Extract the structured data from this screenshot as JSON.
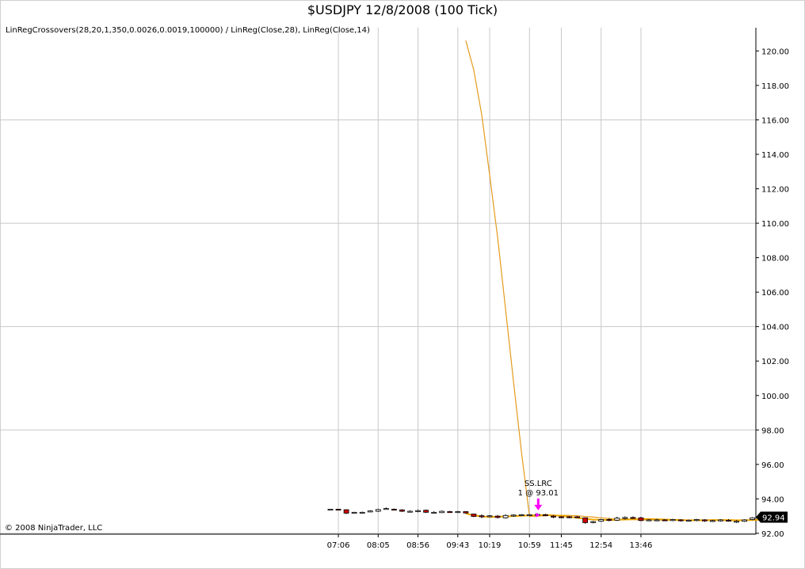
{
  "chart_data": {
    "type": "candlestick",
    "title": "$USDJPY  12/8/2008 (100 Tick)",
    "indicator_label": "LinRegCrossovers(28,20,1,350,0.0026,0.0019,100000) / LinReg(Close,28), LinReg(Close,14)",
    "copyright": "© 2008 NinjaTrader, LLC",
    "ylim": [
      91.95,
      121.35
    ],
    "y_ticks": [
      92.0,
      94.0,
      96.0,
      98.0,
      100.0,
      102.0,
      104.0,
      106.0,
      108.0,
      110.0,
      112.0,
      114.0,
      116.0,
      118.0,
      120.0
    ],
    "y_tick_labels": [
      "92.00",
      "94.00",
      "96.00",
      "98.00",
      "100.00",
      "102.00",
      "104.00",
      "106.00",
      "108.00",
      "110.00",
      "112.00",
      "114.00",
      "116.00",
      "118.00",
      "120.00"
    ],
    "y_major_grid": [
      92.0,
      98.0,
      104.0,
      110.0,
      116.0
    ],
    "x_labels": [
      "07:06",
      "08:05",
      "08:56",
      "09:43",
      "10:19",
      "10:59",
      "11:45",
      "12:54",
      "13:46"
    ],
    "bar_count": 55,
    "x_label_bars": [
      1,
      6,
      11,
      16,
      20,
      25,
      29,
      34,
      39
    ],
    "candles": [
      {
        "o": 93.4,
        "h": 93.42,
        "l": 93.38,
        "c": 93.4
      },
      {
        "o": 93.4,
        "h": 93.42,
        "l": 93.36,
        "c": 93.38
      },
      {
        "o": 93.37,
        "h": 93.4,
        "l": 93.12,
        "c": 93.17
      },
      {
        "o": 93.18,
        "h": 93.25,
        "l": 93.15,
        "c": 93.22
      },
      {
        "o": 93.22,
        "h": 93.26,
        "l": 93.18,
        "c": 93.22
      },
      {
        "o": 93.24,
        "h": 93.34,
        "l": 93.22,
        "c": 93.3
      },
      {
        "o": 93.28,
        "h": 93.42,
        "l": 93.24,
        "c": 93.38
      },
      {
        "o": 93.44,
        "h": 93.5,
        "l": 93.4,
        "c": 93.44
      },
      {
        "o": 93.4,
        "h": 93.44,
        "l": 93.34,
        "c": 93.38
      },
      {
        "o": 93.36,
        "h": 93.4,
        "l": 93.24,
        "c": 93.28
      },
      {
        "o": 93.28,
        "h": 93.34,
        "l": 93.22,
        "c": 93.28
      },
      {
        "o": 93.26,
        "h": 93.38,
        "l": 93.22,
        "c": 93.32
      },
      {
        "o": 93.34,
        "h": 93.38,
        "l": 93.18,
        "c": 93.22
      },
      {
        "o": 93.22,
        "h": 93.28,
        "l": 93.16,
        "c": 93.22
      },
      {
        "o": 93.2,
        "h": 93.32,
        "l": 93.18,
        "c": 93.28
      },
      {
        "o": 93.26,
        "h": 93.3,
        "l": 93.2,
        "c": 93.24
      },
      {
        "o": 93.22,
        "h": 93.3,
        "l": 93.18,
        "c": 93.26
      },
      {
        "o": 93.26,
        "h": 93.28,
        "l": 93.14,
        "c": 93.18
      },
      {
        "o": 93.12,
        "h": 93.14,
        "l": 92.94,
        "c": 92.98
      },
      {
        "o": 93.02,
        "h": 93.1,
        "l": 92.88,
        "c": 92.96
      },
      {
        "o": 92.98,
        "h": 93.06,
        "l": 92.92,
        "c": 93.02
      },
      {
        "o": 93.0,
        "h": 93.06,
        "l": 92.86,
        "c": 92.92
      },
      {
        "o": 92.9,
        "h": 93.1,
        "l": 92.86,
        "c": 93.04
      },
      {
        "o": 93.02,
        "h": 93.1,
        "l": 92.96,
        "c": 93.06
      },
      {
        "o": 93.04,
        "h": 93.12,
        "l": 93.0,
        "c": 93.08
      },
      {
        "o": 93.06,
        "h": 93.12,
        "l": 93.0,
        "c": 93.08
      },
      {
        "o": 93.06,
        "h": 93.16,
        "l": 93.02,
        "c": 93.1
      },
      {
        "o": 93.08,
        "h": 93.14,
        "l": 93.0,
        "c": 93.02
      },
      {
        "o": 93.0,
        "h": 93.06,
        "l": 92.88,
        "c": 92.94
      },
      {
        "o": 92.96,
        "h": 93.0,
        "l": 92.88,
        "c": 92.94
      },
      {
        "o": 92.96,
        "h": 93.0,
        "l": 92.88,
        "c": 92.94
      },
      {
        "o": 92.96,
        "h": 93.0,
        "l": 92.9,
        "c": 92.92
      },
      {
        "o": 92.9,
        "h": 92.92,
        "l": 92.56,
        "c": 92.62
      },
      {
        "o": 92.66,
        "h": 92.72,
        "l": 92.58,
        "c": 92.68
      },
      {
        "o": 92.7,
        "h": 92.84,
        "l": 92.66,
        "c": 92.8
      },
      {
        "o": 92.8,
        "h": 92.88,
        "l": 92.7,
        "c": 92.78
      },
      {
        "o": 92.76,
        "h": 92.96,
        "l": 92.72,
        "c": 92.88
      },
      {
        "o": 92.86,
        "h": 92.98,
        "l": 92.8,
        "c": 92.92
      },
      {
        "o": 92.92,
        "h": 92.98,
        "l": 92.84,
        "c": 92.88
      },
      {
        "o": 92.9,
        "h": 92.96,
        "l": 92.7,
        "c": 92.74
      },
      {
        "o": 92.74,
        "h": 92.82,
        "l": 92.7,
        "c": 92.78
      },
      {
        "o": 92.76,
        "h": 92.84,
        "l": 92.7,
        "c": 92.78
      },
      {
        "o": 92.78,
        "h": 92.82,
        "l": 92.72,
        "c": 92.76
      },
      {
        "o": 92.74,
        "h": 92.84,
        "l": 92.7,
        "c": 92.8
      },
      {
        "o": 92.78,
        "h": 92.82,
        "l": 92.68,
        "c": 92.74
      },
      {
        "o": 92.72,
        "h": 92.8,
        "l": 92.68,
        "c": 92.76
      },
      {
        "o": 92.76,
        "h": 92.84,
        "l": 92.7,
        "c": 92.8
      },
      {
        "o": 92.78,
        "h": 92.82,
        "l": 92.66,
        "c": 92.72
      },
      {
        "o": 92.72,
        "h": 92.78,
        "l": 92.66,
        "c": 92.74
      },
      {
        "o": 92.72,
        "h": 92.82,
        "l": 92.68,
        "c": 92.78
      },
      {
        "o": 92.76,
        "h": 92.82,
        "l": 92.68,
        "c": 92.74
      },
      {
        "o": 92.7,
        "h": 92.76,
        "l": 92.6,
        "c": 92.7
      },
      {
        "o": 92.7,
        "h": 92.82,
        "l": 92.66,
        "c": 92.78
      },
      {
        "o": 92.8,
        "h": 92.94,
        "l": 92.76,
        "c": 92.9
      },
      {
        "o": 92.9,
        "h": 92.96,
        "l": 92.86,
        "c": 92.94
      }
    ],
    "linreg_28": {
      "name": "LinReg(Close,28)",
      "color": "#e39b1d",
      "start_bar": 17,
      "values": [
        120.6,
        118.9,
        116.3,
        112.8,
        109.2,
        105.0,
        100.8,
        96.7,
        92.98,
        93.0,
        93.02,
        93.04,
        93.05,
        93.04,
        93.02,
        92.98,
        92.94,
        92.9,
        92.86,
        92.82,
        92.8,
        92.79,
        92.78,
        92.78,
        92.77,
        92.77,
        92.76,
        92.76,
        92.76,
        92.75,
        92.75,
        92.75,
        92.75,
        92.74,
        92.74,
        92.75,
        92.76,
        92.77
      ]
    },
    "linreg_14": {
      "name": "LinReg(Close,14)",
      "color": "#f0a800",
      "start_bar": 17,
      "values": [
        93.15,
        93.05,
        92.98,
        92.95,
        92.96,
        92.98,
        93.0,
        93.02,
        93.04,
        93.05,
        93.06,
        93.05,
        93.02,
        92.96,
        92.9,
        92.84,
        92.8,
        92.78,
        92.77,
        92.78,
        92.8,
        92.82,
        92.83,
        92.83,
        92.82,
        92.8,
        92.78,
        92.77,
        92.76,
        92.76,
        92.76,
        92.77,
        92.77,
        92.77,
        92.76,
        92.76,
        92.77,
        92.8
      ]
    },
    "signal": {
      "label_line1": "SS.LRC",
      "label_line2": "1 @ 93.01",
      "bar": 26,
      "price": 93.01,
      "color": "#ff00ff"
    },
    "last_price": {
      "label": "92.94",
      "value": 92.94
    },
    "colors": {
      "up_fill": "#e8e8e8",
      "down_fill": "#cc0000",
      "wick": "#000000",
      "grid": "#c8c8c8",
      "axis": "#000000"
    }
  }
}
